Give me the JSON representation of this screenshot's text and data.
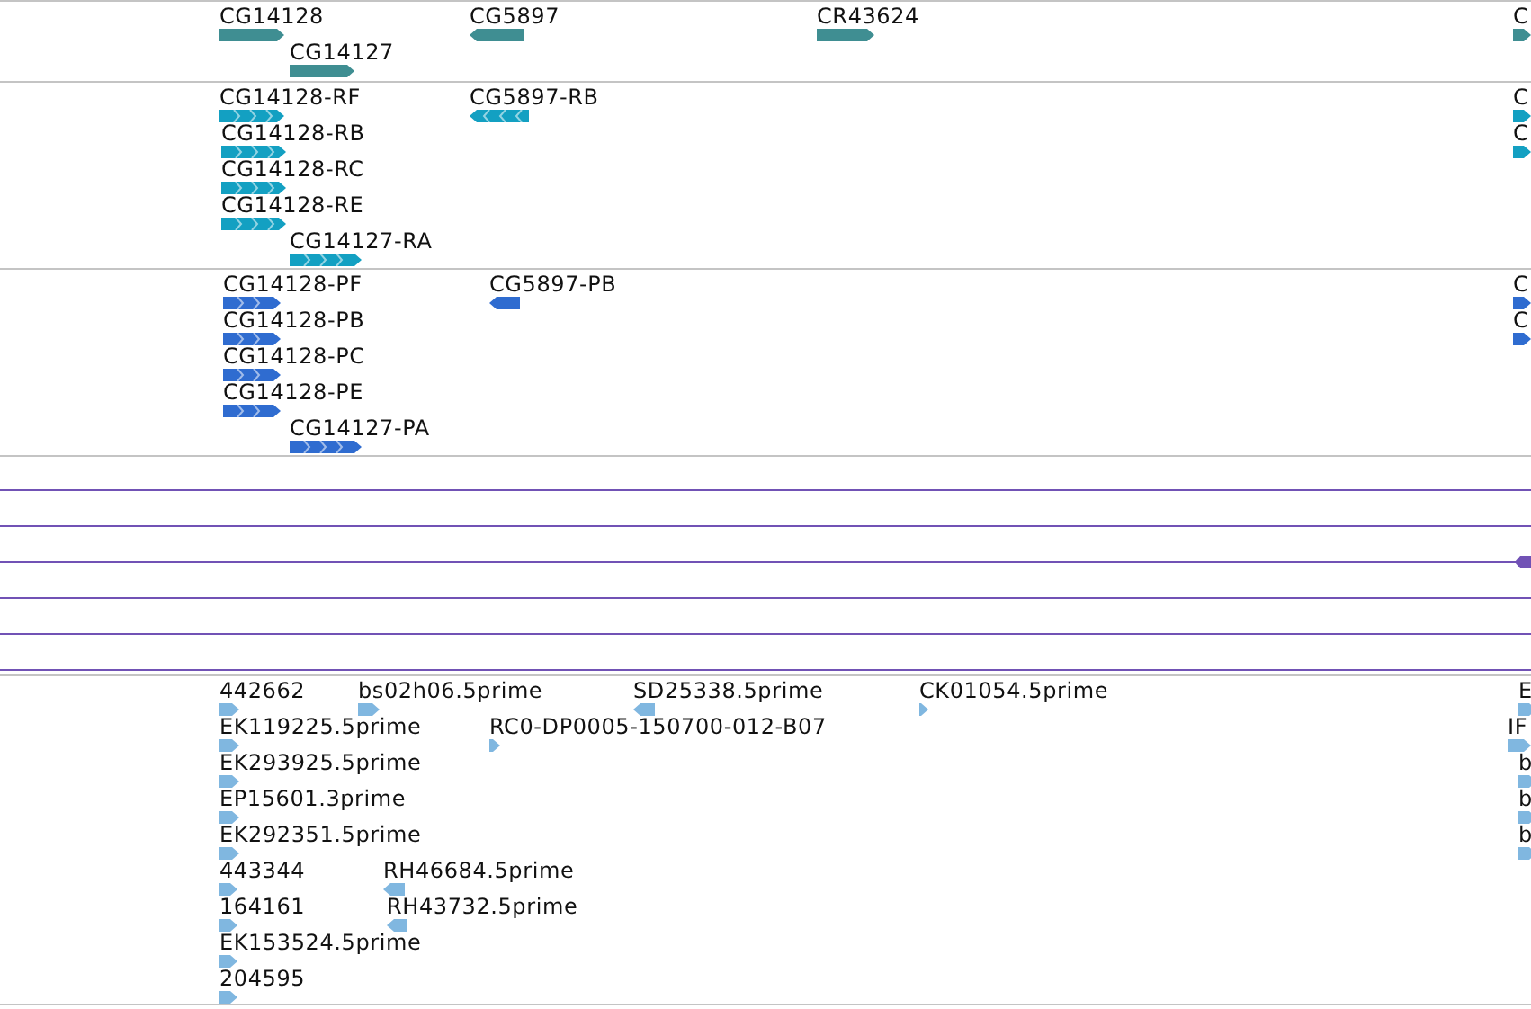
{
  "tracks": [
    {
      "kind": "gene",
      "color": "#3f8e92",
      "features": [
        {
          "label": "CG14128",
          "reverse": false
        },
        {
          "label": "CG14127",
          "reverse": false
        },
        {
          "label": "CG5897",
          "reverse": true
        },
        {
          "label": "CR43624",
          "reverse": false
        },
        {
          "label": "C",
          "reverse": false
        }
      ]
    },
    {
      "kind": "transcript",
      "color": "#13a0c2",
      "features": [
        {
          "label": "CG14128-RF",
          "reverse": false
        },
        {
          "label": "CG14128-RB",
          "reverse": false
        },
        {
          "label": "CG14128-RC",
          "reverse": false
        },
        {
          "label": "CG14128-RE",
          "reverse": false
        },
        {
          "label": "CG14127-RA",
          "reverse": false
        },
        {
          "label": "CG5897-RB",
          "reverse": true
        },
        {
          "label": "C",
          "reverse": false
        },
        {
          "label": "C",
          "reverse": false
        }
      ]
    },
    {
      "kind": "transcript",
      "color": "#2f6cd0",
      "features": [
        {
          "label": "CG14128-PF",
          "reverse": false
        },
        {
          "label": "CG14128-PB",
          "reverse": false
        },
        {
          "label": "CG14128-PC",
          "reverse": false
        },
        {
          "label": "CG14128-PE",
          "reverse": false
        },
        {
          "label": "CG14127-PA",
          "reverse": false
        },
        {
          "label": "CG5897-PB",
          "reverse": true
        },
        {
          "label": "C",
          "reverse": false
        },
        {
          "label": "C",
          "reverse": false
        }
      ]
    },
    {
      "kind": "alignment",
      "color": "#7152b5"
    },
    {
      "kind": "est",
      "color": "#80b7e0",
      "features": [
        {
          "label": "442662",
          "reverse": false
        },
        {
          "label": "bs02h06.5prime",
          "reverse": false
        },
        {
          "label": "SD25338.5prime",
          "reverse": true
        },
        {
          "label": "CK01054.5prime",
          "reverse": false
        },
        {
          "label": "E",
          "reverse": false
        },
        {
          "label": "EK119225.5prime",
          "reverse": false
        },
        {
          "label": "RC0-DP0005-150700-012-B07",
          "reverse": false
        },
        {
          "label": "IF",
          "reverse": false
        },
        {
          "label": "EK293925.5prime",
          "reverse": false
        },
        {
          "label": "b",
          "reverse": false
        },
        {
          "label": "EP15601.3prime",
          "reverse": false
        },
        {
          "label": "b",
          "reverse": false
        },
        {
          "label": "EK292351.5prime",
          "reverse": false
        },
        {
          "label": "b",
          "reverse": false
        },
        {
          "label": "443344",
          "reverse": false
        },
        {
          "label": "RH46684.5prime",
          "reverse": true
        },
        {
          "label": "164161",
          "reverse": false
        },
        {
          "label": "RH43732.5prime",
          "reverse": true
        },
        {
          "label": "EK153524.5prime",
          "reverse": false
        },
        {
          "label": "204595",
          "reverse": false
        }
      ]
    }
  ]
}
